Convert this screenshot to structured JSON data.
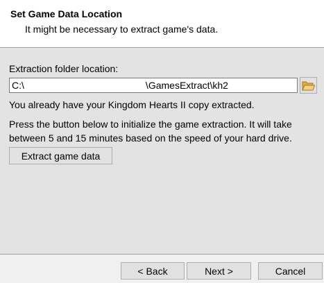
{
  "header": {
    "title": "Set Game Data Location",
    "subtitle": "It might be necessary to extract game's data."
  },
  "main": {
    "folder_label": "Extraction folder location:",
    "folder_path": "C:\\                                             \\GamesExtract\\kh2",
    "browse_icon": "folder-open-icon",
    "status_text": "You already have your Kingdom Hearts II copy extracted.",
    "info_lines": [
      "Press the button below to initialize the game extraction. It will take",
      "between 5 and 15 minutes based on the speed of your hard drive."
    ],
    "extract_button_label": "Extract game data"
  },
  "footer": {
    "back_label": "< Back",
    "next_label": "Next >",
    "cancel_label": "Cancel"
  },
  "colors": {
    "header_background": "#ffffff",
    "content_background": "#e3e3e3",
    "button_background": "#e1e1e1",
    "folder_icon": "#e8c36a"
  }
}
